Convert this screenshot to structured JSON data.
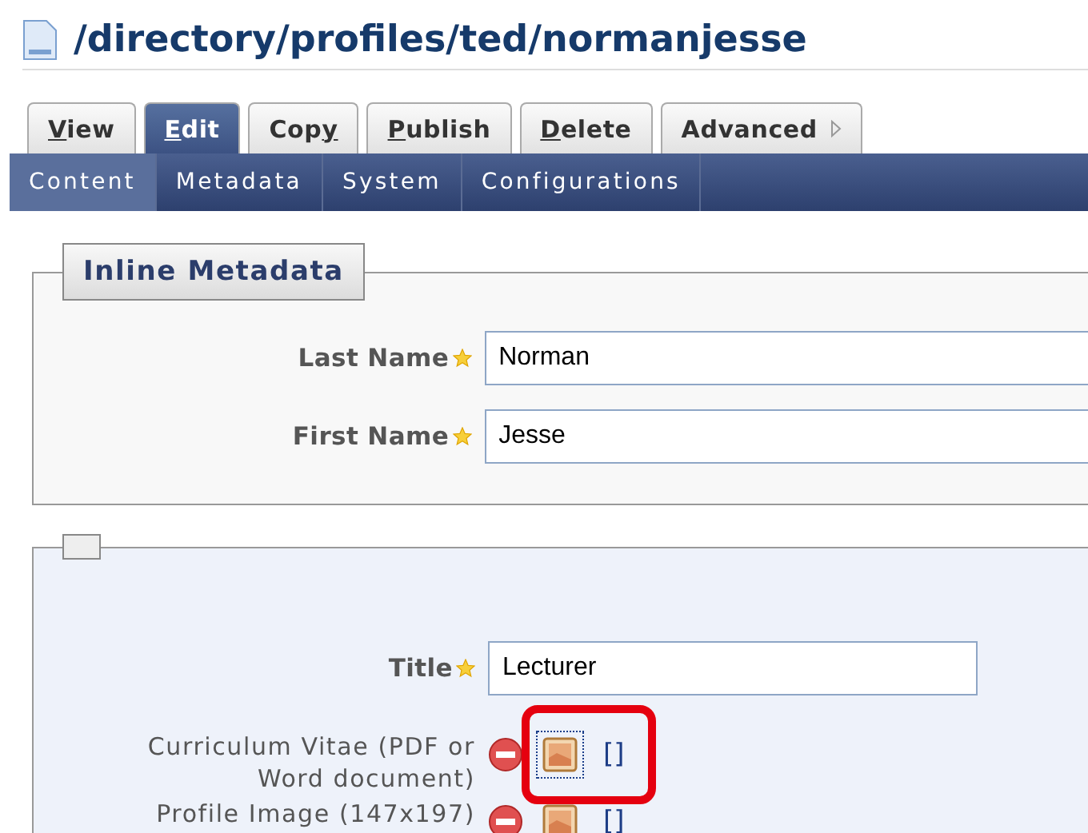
{
  "path": "/directory/profiles/ted/normanjesse",
  "tabs": [
    {
      "key": "V",
      "after": "iew",
      "selected": false
    },
    {
      "key": "E",
      "after": "dit",
      "selected": true
    },
    {
      "before": "Cop",
      "key": "y",
      "selected": false
    },
    {
      "key": "P",
      "after": "ublish",
      "selected": false
    },
    {
      "key": "D",
      "after": "elete",
      "selected": false
    },
    {
      "before": "Advanced",
      "kind": "menu",
      "selected": false
    }
  ],
  "subnav": [
    {
      "label": "Content",
      "selected": true
    },
    {
      "label": "Metadata",
      "selected": false
    },
    {
      "label": "System",
      "selected": false
    },
    {
      "label": "Configurations",
      "selected": false
    }
  ],
  "sections": [
    {
      "legend": "Inline Metadata",
      "kind": "plain",
      "fields": [
        {
          "kind": "long-text",
          "label": "Last Name",
          "required": true,
          "value": "Norman"
        },
        {
          "kind": "long-text",
          "label": "First Name",
          "required": true,
          "value": "Jesse"
        }
      ]
    },
    {
      "kind": "tinted",
      "fields": [
        {
          "kind": "short-text",
          "label": "Title",
          "required": true,
          "value": "Lecturer"
        },
        {
          "kind": "file",
          "label": "Curriculum Vitae (PDF or Word document)",
          "required": false,
          "value": "[]",
          "highlighted": true
        },
        {
          "kind": "file",
          "label": "Profile Image (147x197)",
          "required": false,
          "value": "[]",
          "highlighted": false
        }
      ]
    }
  ]
}
